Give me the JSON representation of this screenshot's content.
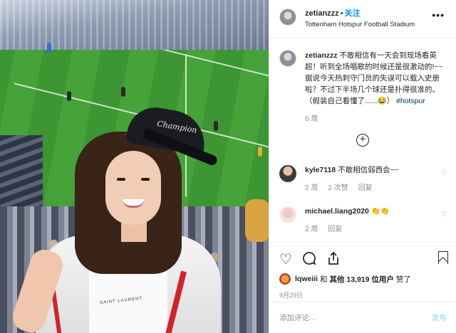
{
  "post": {
    "username": "zetianzzz",
    "separator": "•",
    "follow_label": "关注",
    "location": "Tottenham Hotspur Football Stadium",
    "more_icon": "more-horizontal-icon",
    "photo_shirt_text": "SAINT LAURENT",
    "photo_cap_logo": "Champion"
  },
  "caption": {
    "username": "zetianzzz",
    "text": "不敢相信有一天会到现场看英超！听到全场唱歌的时候还是很激动的!~~据说今天热刺守门员的失误可以载入史册啦？不过下半场几个球还是扑得很准的。（假装自己看懂了......😂）",
    "hashtag": "#hotspur",
    "time": "6 周"
  },
  "load_more_icon": "plus-circle-icon",
  "comments": [
    {
      "username": "kyle7118",
      "text": "不敢相信弱西会~~",
      "time": "2 周",
      "likes": "2 次赞",
      "reply": "回复"
    },
    {
      "username": "michael.liang2020",
      "text": "👏👏",
      "time": "2 周",
      "reply": "回复"
    }
  ],
  "actions": {
    "like_icon": "heart-icon",
    "comment_icon": "comment-icon",
    "share_icon": "share-icon",
    "save_icon": "bookmark-icon",
    "liked_by_user": "lqweiii",
    "liked_by_mid": " 和 ",
    "liked_by_others": "其他 13,919 位用户",
    "liked_by_suffix": " 赞了",
    "date": "9月29日"
  },
  "add_comment": {
    "placeholder": "添加评论...",
    "post_label": "发布"
  },
  "colors": {
    "accent": "#0095f6",
    "hashtag": "#00376b",
    "muted": "#8e8e8e"
  }
}
